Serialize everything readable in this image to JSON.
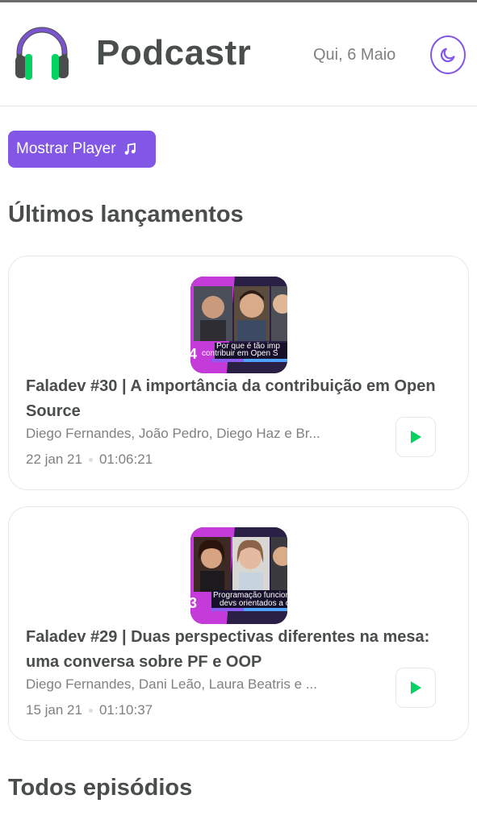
{
  "header": {
    "brand": "Podcastr",
    "date": "Qui, 6 Maio"
  },
  "toolbar": {
    "show_player_label": "Mostrar Player"
  },
  "sections": {
    "latest_title": "Últimos lançamentos",
    "all_title": "Todos episódios"
  },
  "episodes": [
    {
      "title": "Faladev #30 | A importância da contribuição em Open Source",
      "members": "Diego Fernandes, João Pedro, Diego Haz e Br...",
      "published": "22 jan 21",
      "duration": "01:06:21",
      "thumb_caption_1": "Por que é tão imp",
      "thumb_caption_2": "contribuir em Open S",
      "thumb_number": "4"
    },
    {
      "title": "Faladev #29 | Duas perspectivas diferentes na mesa: uma conversa sobre PF e OOP",
      "members": "Diego Fernandes, Dani Leão, Laura Beatris e ...",
      "published": "15 jan 21",
      "duration": "01:10:37",
      "thumb_caption_1": "Programação funcion",
      "thumb_caption_2": "devs orientados a o",
      "thumb_number": "3"
    }
  ],
  "colors": {
    "accent": "#8257e5",
    "play": "#04d361",
    "text": "#494d4b",
    "muted": "#808080"
  },
  "icons": {
    "logo": "headphones-icon",
    "theme": "moon-icon",
    "player": "music-note-icon",
    "play": "play-icon"
  }
}
